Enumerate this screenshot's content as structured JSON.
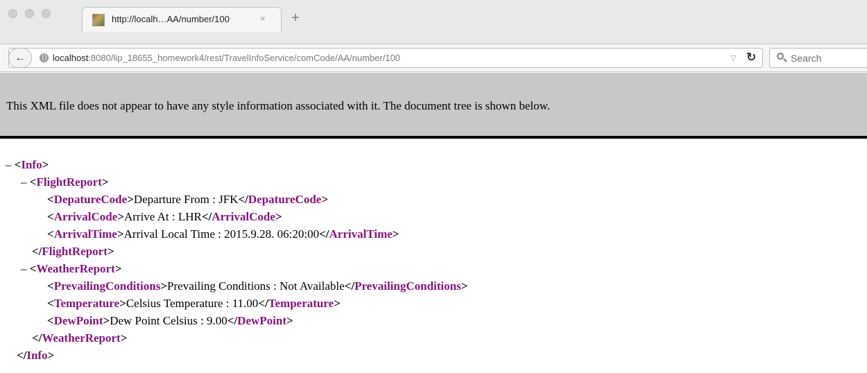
{
  "browser": {
    "tab": {
      "title": "http://localh…AA/number/100",
      "close_glyph": "×"
    },
    "new_tab_glyph": "+",
    "url": {
      "host": "localhost",
      "rest": ":8080/lip_18655_homework4/rest/TravelInfoService/comCode/AA/number/100"
    },
    "search": {
      "placeholder": "Search"
    },
    "icons": {
      "back": "back-arrow-icon",
      "globe": "globe-icon",
      "reload": "reload-icon",
      "search": "search-icon",
      "dropmarker": "dropdown-triangle-icon"
    }
  },
  "page": {
    "banner": "This XML file does not appear to have any style information associated with it. The document tree is shown below.",
    "collapse_glyph": "–",
    "xml": {
      "info": {
        "tag": "Info"
      },
      "flight_report": {
        "tag": "FlightReport",
        "items": [
          {
            "tag": "DepatureCode",
            "text": "Departure From : JFK"
          },
          {
            "tag": "ArrivalCode",
            "text": "Arrive At : LHR"
          },
          {
            "tag": "ArrivalTime",
            "text": "Arrival Local Time : 2015.9.28. 06:20:00"
          }
        ]
      },
      "weather_report": {
        "tag": "WeatherReport",
        "items": [
          {
            "tag": "PrevailingConditions",
            "text": "Prevailing Conditions : Not Available"
          },
          {
            "tag": "Temperature",
            "text": "Celsius Temperature : 11.00"
          },
          {
            "tag": "DewPoint",
            "text": "Dew Point Celsius : 9.00"
          }
        ]
      }
    }
  },
  "colors": {
    "tag": "#881280",
    "banner_bg": "#c8c8c8"
  }
}
